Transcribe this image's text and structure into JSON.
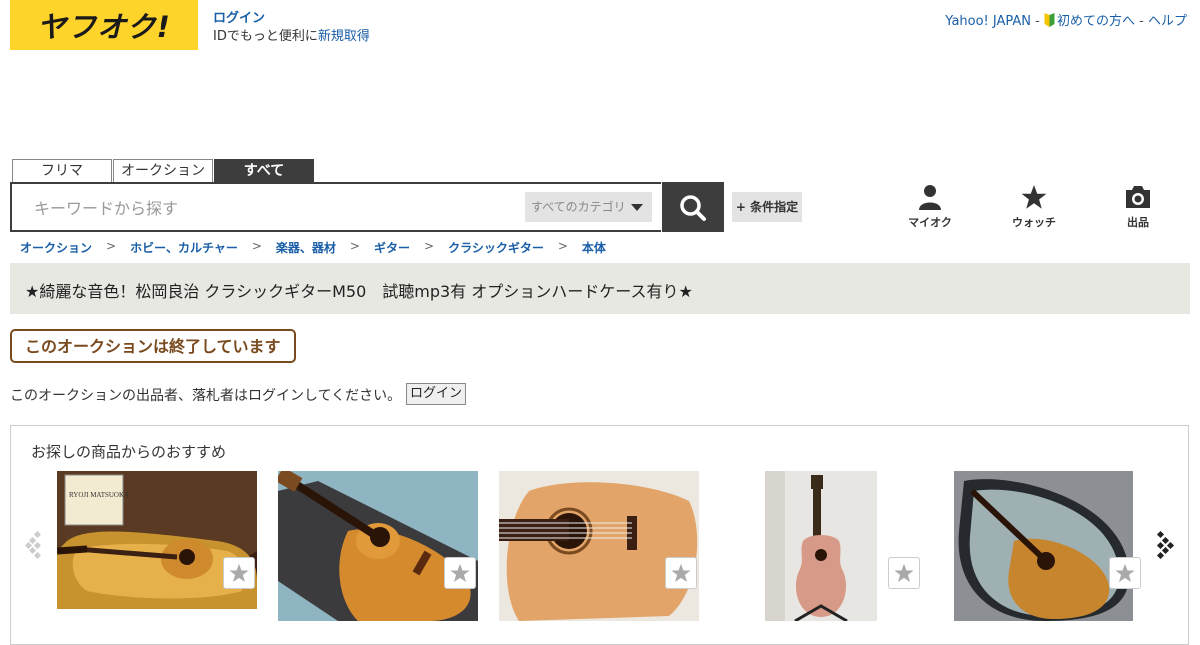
{
  "header": {
    "logo_text": "ヤフオク!",
    "login_label": "ログイン",
    "id_text": "IDでもっと便利に",
    "signup_label": "新規取得",
    "yahoo_label": "Yahoo! JAPAN",
    "sep1": " - ",
    "beginner_label": "初めての方へ",
    "sep2": " - ",
    "help_label": "ヘルプ"
  },
  "tabs": [
    "フリマ",
    "オークション",
    "すべて"
  ],
  "search": {
    "placeholder": "キーワードから探す",
    "category_label": "すべてのカテゴリ",
    "condition_label": "+ 条件指定"
  },
  "nav": {
    "myauction": "マイオク",
    "watch": "ウォッチ",
    "sell": "出品"
  },
  "breadcrumb": [
    "オークション",
    "ホビー、カルチャー",
    "楽器、器材",
    "ギター",
    "クラシックギター",
    "本体"
  ],
  "breadcrumb_sep": ">",
  "title": "★綺麗な音色！松岡良治 クラシックギターM50　試聴mp3有 オプションハードケース有り★",
  "ended_label": "このオークションは終了しています",
  "login_notice": "このオークションの出品者、落札者はログインしてください。",
  "login_button": "ログイン",
  "recommend": {
    "title": "お探しの商品からのおすすめ",
    "items": [
      {
        "label_text": "RYOJI MATSUOKA"
      },
      {},
      {},
      {},
      {}
    ]
  },
  "colors": {
    "brand_yellow": "#ffd42a",
    "link_blue": "#1a5fa8",
    "ended_brown": "#7a4a1f",
    "dark": "#3d3d3d"
  }
}
